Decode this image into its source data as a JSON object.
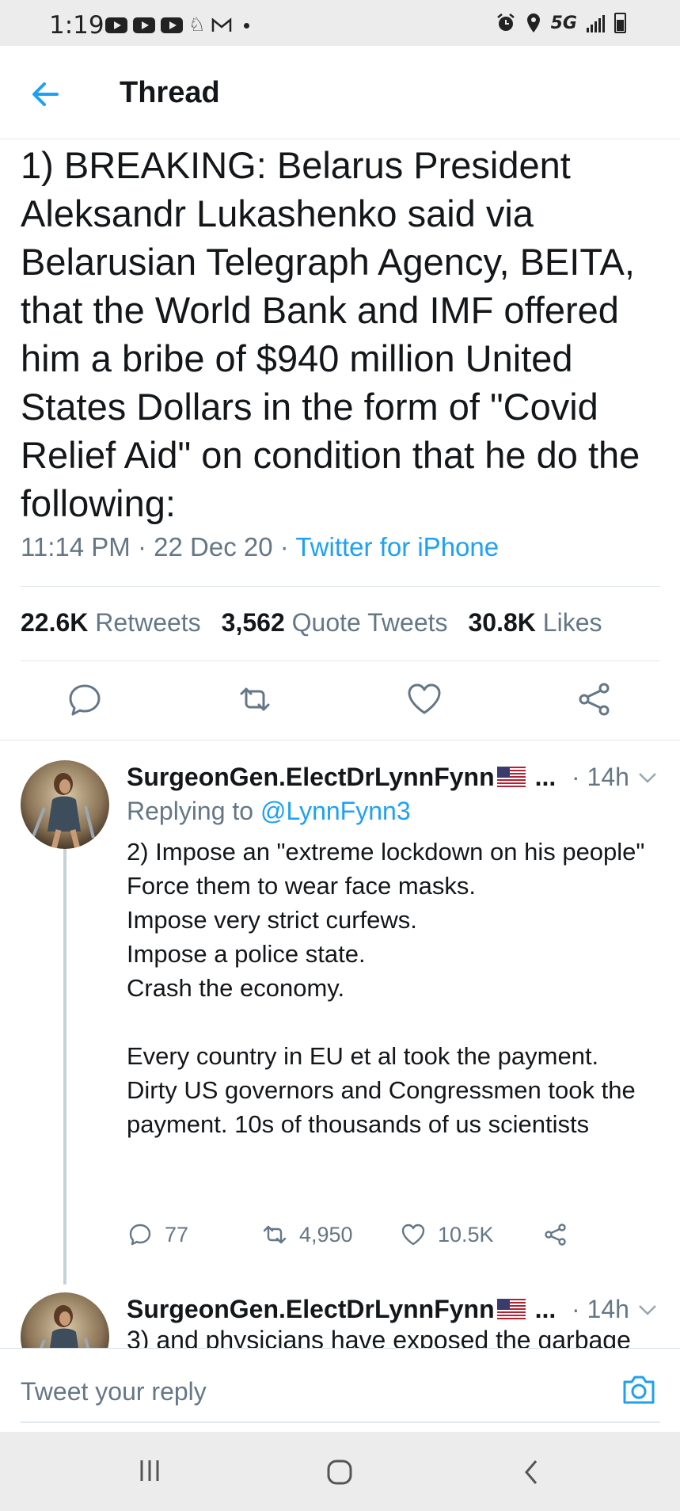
{
  "status_bar": {
    "time": "1:19",
    "network": "5G",
    "icons": [
      "youtube-icon",
      "youtube-icon",
      "youtube-icon",
      "notification-icon",
      "gmail-icon",
      "dot-icon",
      "alarm-icon",
      "location-icon",
      "signal-icon",
      "battery-icon"
    ]
  },
  "header": {
    "title": "Thread",
    "back_icon": "back-arrow-icon"
  },
  "tweet": {
    "text": "1) BREAKING: Belarus President Aleksandr Lukashenko said via Belarusian Telegraph Agency, BEITA, that the World Bank and IMF offered him a bribe of $940 million United States Dollars in the form of \"Covid Relief Aid\" on condition that he do the following:",
    "time": "11:14 PM",
    "date": "22 Dec 20",
    "source": "Twitter for iPhone",
    "retweets_count": "22.6K",
    "retweets_label": "Retweets",
    "quotes_count": "3,562",
    "quotes_label": "Quote Tweets",
    "likes_count": "30.8K",
    "likes_label": "Likes"
  },
  "replies": [
    {
      "name": "SurgeonGen.ElectDrLynnFynn",
      "name_suffix": "...",
      "time": "· 14h",
      "replying_prefix": "Replying to",
      "replying_handle": "@LynnFynn3",
      "body": "2) Impose an \"extreme lockdown on his people\"\nForce them to wear face masks.\nImpose very strict curfews.\nImpose a police state.\nCrash the economy.\n\nEvery country in EU et al took the payment. Dirty US governors and Congressmen took the payment. 10s of thousands of us scientists",
      "reply_count": "77",
      "retweet_count": "4,950",
      "like_count": "10.5K"
    },
    {
      "name": "SurgeonGen.ElectDrLynnFynn",
      "name_suffix": "...",
      "time": "· 14h",
      "body": "3) and physicians have exposed the garbage"
    }
  ],
  "composer": {
    "placeholder": "Tweet your reply"
  },
  "colors": {
    "accent": "#1da1f2",
    "secondary_text": "#657786",
    "primary_text": "#14171a",
    "divider": "#e1e8ed"
  }
}
